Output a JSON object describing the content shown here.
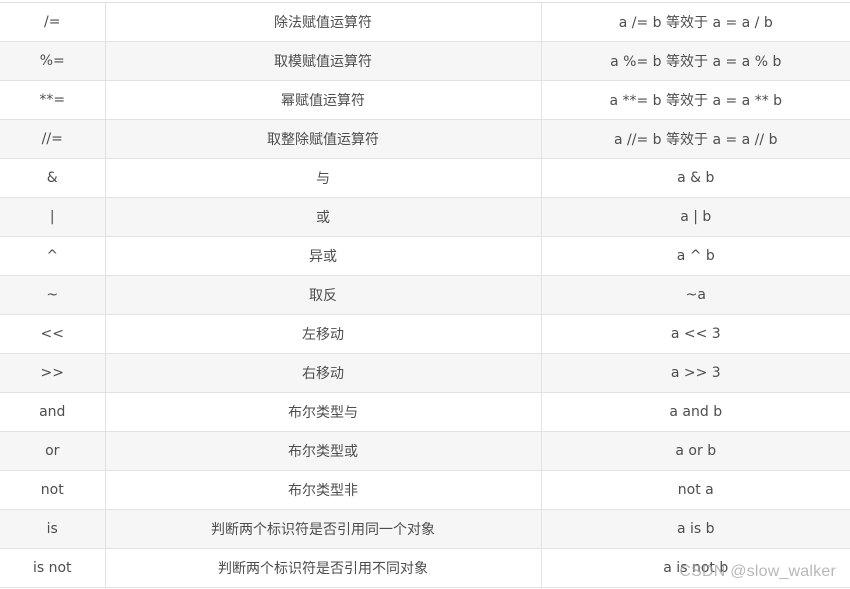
{
  "rows": [
    {
      "op": "/=",
      "desc": "除法赋值运算符",
      "example": "a /= b 等效于 a = a / b"
    },
    {
      "op": "%=",
      "desc": "取模赋值运算符",
      "example": "a %= b 等效于 a = a % b"
    },
    {
      "op": "**=",
      "desc": "幂赋值运算符",
      "example": "a **= b 等效于 a = a ** b"
    },
    {
      "op": "//=",
      "desc": "取整除赋值运算符",
      "example": "a //= b 等效于 a = a // b"
    },
    {
      "op": "&",
      "desc": "与",
      "example": "a & b"
    },
    {
      "op": "|",
      "desc": "或",
      "example": "a | b"
    },
    {
      "op": "^",
      "desc": "异或",
      "example": "a ^ b"
    },
    {
      "op": "~",
      "desc": "取反",
      "example": "~a"
    },
    {
      "op": "<<",
      "desc": "左移动",
      "example": "a << 3"
    },
    {
      "op": ">>",
      "desc": "右移动",
      "example": "a >> 3"
    },
    {
      "op": "and",
      "desc": "布尔类型与",
      "example": "a and b"
    },
    {
      "op": "or",
      "desc": "布尔类型或",
      "example": "a or b"
    },
    {
      "op": "not",
      "desc": "布尔类型非",
      "example": "not a"
    },
    {
      "op": "is",
      "desc": "判断两个标识符是否引用同一个对象",
      "example": "a is b"
    },
    {
      "op": "is not",
      "desc": "判断两个标识符是否引用不同对象",
      "example": "a is not b"
    }
  ],
  "watermark": "CSDN @slow_walker"
}
